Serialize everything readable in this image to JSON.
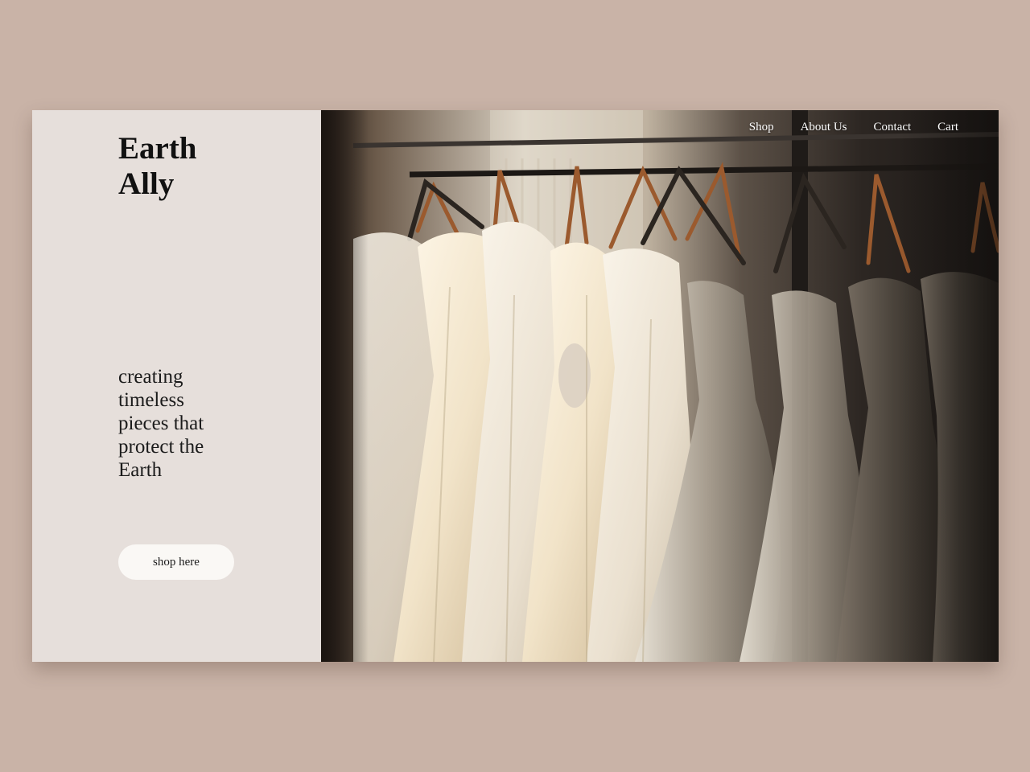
{
  "brand": {
    "line1": "Earth",
    "line2": "Ally"
  },
  "hero": {
    "tagline": "creating timeless pieces that protect the Earth",
    "cta_label": "shop here",
    "image": "wedding-dresses-on-hangers-photo"
  },
  "nav": {
    "items": [
      {
        "label": "Shop"
      },
      {
        "label": "About Us"
      },
      {
        "label": "Contact"
      },
      {
        "label": "Cart"
      }
    ]
  },
  "colors": {
    "page_background": "#c9b3a7",
    "left_panel": "#e6dfdb",
    "button_background": "#faf8f5",
    "text_dark": "#111111",
    "nav_text": "#ffffff"
  }
}
